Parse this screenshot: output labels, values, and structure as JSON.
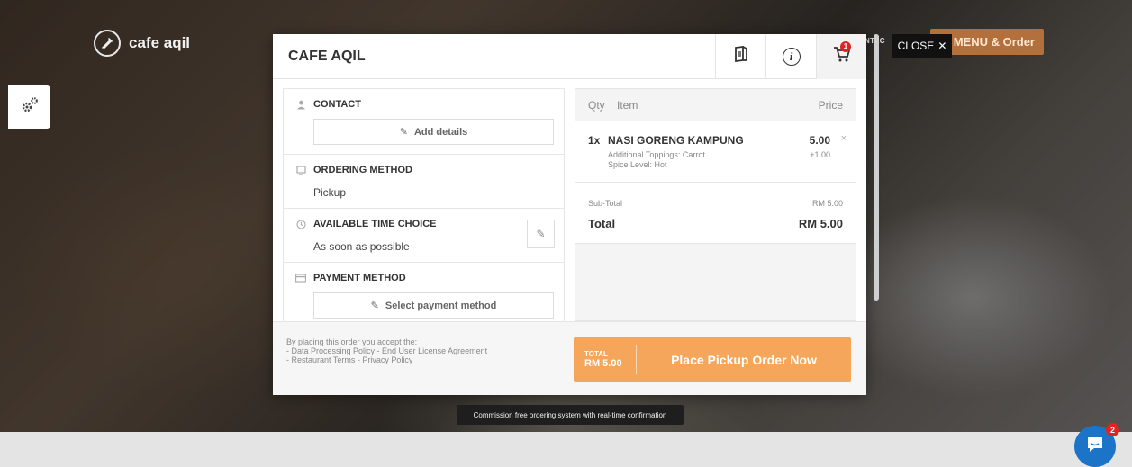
{
  "site": {
    "logo_text": "cafe aqil",
    "contact_fragment": "NTAC",
    "order_button": "e MENU & Order",
    "close_label": "CLOSE"
  },
  "modal": {
    "title": "CAFE AQIL",
    "cart_count": "1"
  },
  "left": {
    "contact": {
      "title": "CONTACT",
      "button": "Add details"
    },
    "ordering": {
      "title": "ORDERING METHOD",
      "value": "Pickup"
    },
    "time": {
      "title": "AVAILABLE TIME CHOICE",
      "value": "As soon as possible"
    },
    "payment": {
      "title": "PAYMENT METHOD",
      "button": "Select payment method"
    }
  },
  "cart": {
    "headers": {
      "qty": "Qty",
      "item": "Item",
      "price": "Price"
    },
    "items": [
      {
        "qty": "1x",
        "name": "NASI GORENG KAMPUNG",
        "price": "5.00",
        "remove": "×",
        "options": [
          "Additional Toppings: Carrot",
          "Spice Level: Hot"
        ],
        "option_price": "+1.00"
      }
    ],
    "subtotal_label": "Sub-Total",
    "subtotal_value": "RM 5.00",
    "total_label": "Total",
    "total_value": "RM 5.00"
  },
  "footer": {
    "terms_intro": "By placing this order you accept the:",
    "dash": "- ",
    "sep": " - ",
    "link_dpp": "Data Processing Policy",
    "link_eula": "End User License Agreement",
    "link_terms": "Restaurant Terms",
    "link_privacy": "Privacy Policy",
    "total_label": "TOTAL",
    "total_value": "RM 5.00",
    "place_label": "Place Pickup Order Now"
  },
  "tooltip": "Commission free ordering system with real-time confirmation",
  "chat": {
    "badge": "2"
  },
  "colors": {
    "accent": "#f5a65b",
    "order_button": "#b3703c",
    "badge_red": "#e02323",
    "chat_blue": "#1b74c8"
  }
}
